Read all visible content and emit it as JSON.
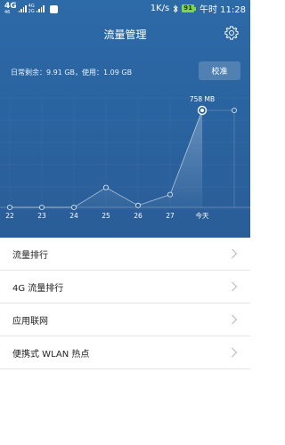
{
  "status_bar": {
    "network": "4G",
    "network_sub": "46",
    "network2_top": "4G",
    "network2_bottom": "2G",
    "speed": "1K/s",
    "battery": "91",
    "time": "午时 11:28"
  },
  "header": {
    "title": "流量管理",
    "usage_text": "日常剩余：9.91 GB，使用：1.09 GB",
    "calibrate_label": "校准"
  },
  "chart_data": {
    "type": "line",
    "categories": [
      "22",
      "23",
      "24",
      "25",
      "26",
      "27",
      "今天",
      ""
    ],
    "values_mb": [
      0,
      0,
      0,
      155,
      15,
      100,
      758,
      758
    ],
    "annotation": "758 MB",
    "highlight_index": 6
  },
  "list": {
    "items": [
      {
        "label": "流量排行"
      },
      {
        "label": "4G 流量排行"
      },
      {
        "label": "应用联网"
      },
      {
        "label": "便携式 WLAN 热点"
      }
    ]
  },
  "colors": {
    "header_bg": "#2a62a0",
    "battery": "#7fd64a"
  }
}
